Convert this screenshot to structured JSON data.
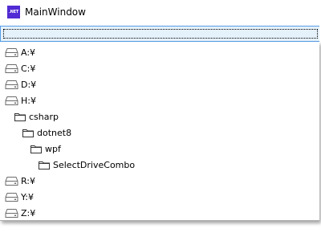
{
  "window": {
    "app_icon_text": ".NET",
    "title": "MainWindow"
  },
  "combo": {
    "selected_value": ""
  },
  "dropdown": {
    "items": [
      {
        "label": "A:¥",
        "icon": "drive-icon",
        "indent": 0
      },
      {
        "label": "C:¥",
        "icon": "drive-icon",
        "indent": 0
      },
      {
        "label": "D:¥",
        "icon": "drive-icon",
        "indent": 0
      },
      {
        "label": "H:¥",
        "icon": "drive-icon",
        "indent": 0
      },
      {
        "label": "csharp",
        "icon": "folder-icon",
        "indent": 1
      },
      {
        "label": "dotnet8",
        "icon": "folder-icon",
        "indent": 2
      },
      {
        "label": "wpf",
        "icon": "folder-icon",
        "indent": 3
      },
      {
        "label": "SelectDriveCombo",
        "icon": "folder-icon",
        "indent": 4
      },
      {
        "label": "R:¥",
        "icon": "drive-icon",
        "indent": 0
      },
      {
        "label": "Y:¥",
        "icon": "drive-icon",
        "indent": 0
      },
      {
        "label": "Z:¥",
        "icon": "drive-icon",
        "indent": 0
      }
    ]
  },
  "colors": {
    "accent": "#569de5",
    "combo_background": "#e5f1fb",
    "app_icon": "#512bd4"
  }
}
